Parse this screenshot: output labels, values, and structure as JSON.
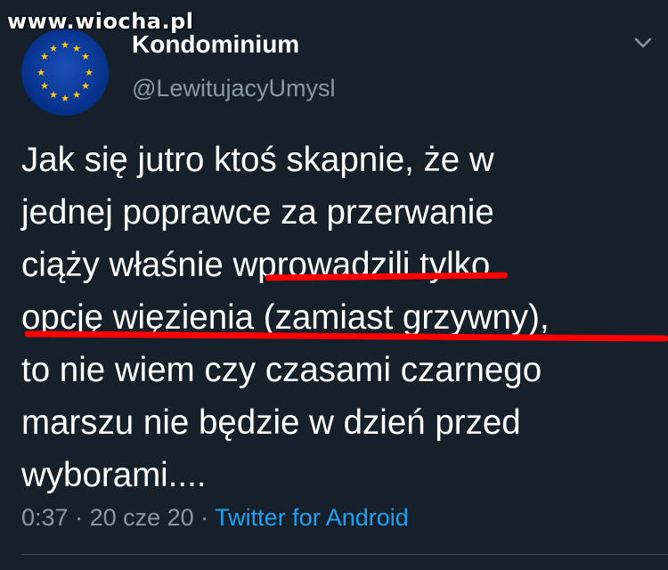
{
  "watermark": "www.wiocha.pl",
  "tweet": {
    "display_name": "Kondominium",
    "handle": "@LewitujacyUmysl",
    "lines": [
      "Jak się jutro ktoś skapnie, że w",
      "jednej poprawce za przerwanie",
      "ciąży właśnie wprowadzili tylko",
      "opcję więzienia (zamiast grzywny),",
      "to nie wiem czy czasami czarnego",
      "marszu nie będzie w dzień przed",
      "wyborami...."
    ],
    "time": "0:37",
    "sep1": " · ",
    "date": "20 cze 20",
    "sep2": " · ",
    "source": "Twitter for Android"
  },
  "icons": {
    "avatar": "eu-flag-avatar",
    "menu": "chevron-down-icon"
  },
  "colors": {
    "background": "#15202b",
    "text": "#ffffff",
    "secondary_text": "#8899a6",
    "link": "#1da1f2",
    "highlight_underline": "#ff0000",
    "avatar_blue": "#003399",
    "avatar_stars": "#ffcc00"
  }
}
